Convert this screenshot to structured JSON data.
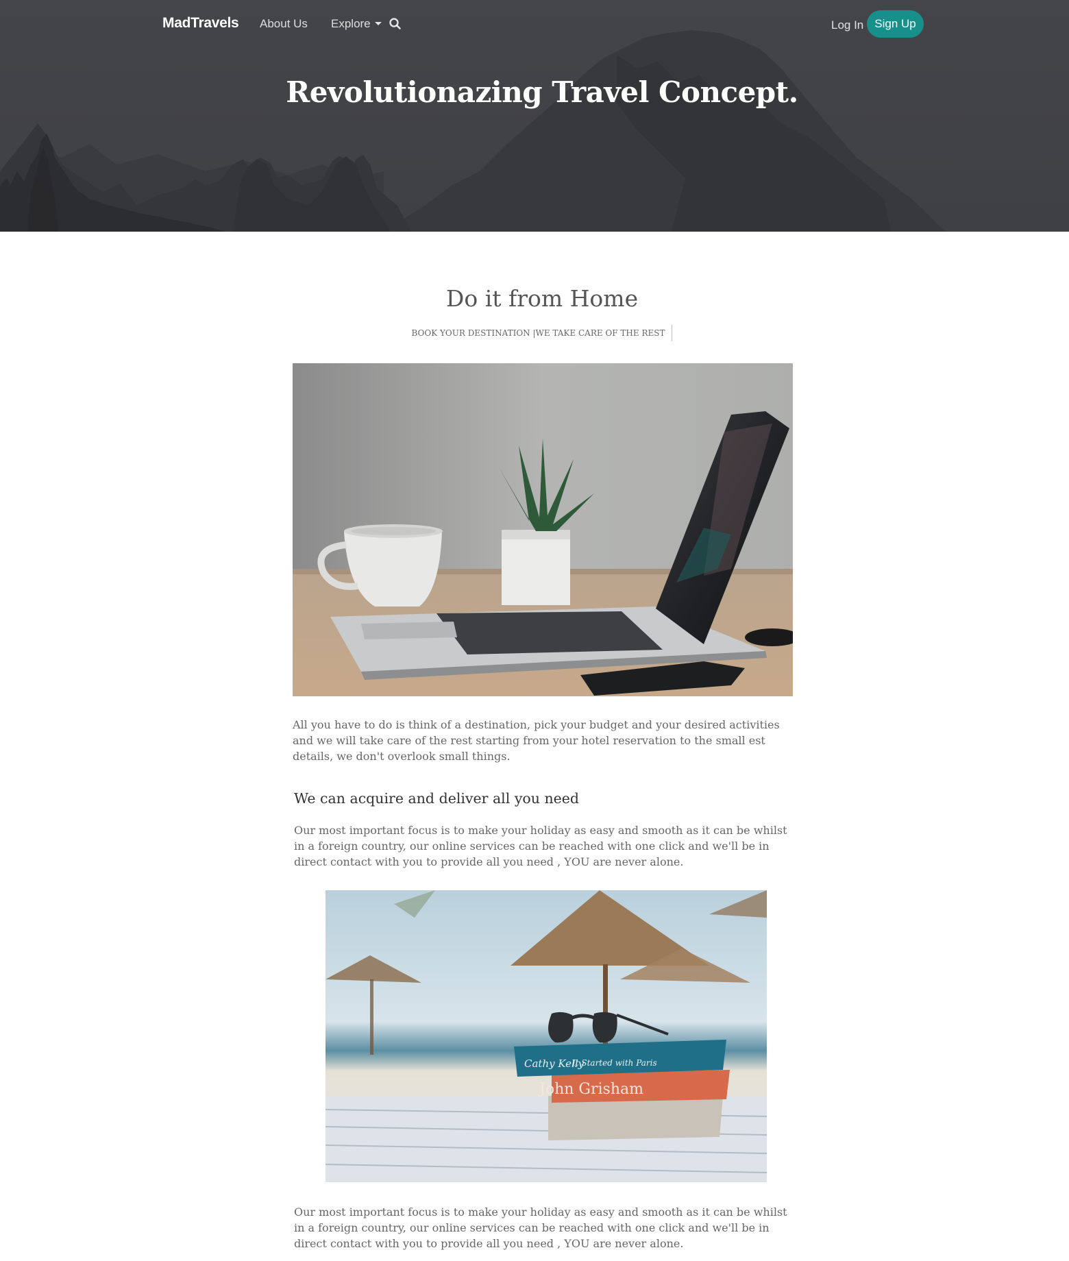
{
  "nav": {
    "brand": "MadTravels",
    "about": "About Us",
    "explore": "Explore",
    "login": "Log In",
    "signup": "Sign Up"
  },
  "hero": {
    "title": "Revolutionazing Travel Concept."
  },
  "intro": {
    "title": "Do it from Home",
    "subtitle": "BOOK YOUR DESTINATION |WE TAKE CARE OF THE REST"
  },
  "content": {
    "para1": "All you have to do is think of a destination, pick your budget and your desired activities and we will take care of the rest starting from your hotel reservation to the small est details, we don't overlook small things.",
    "heading": "We can acquire and deliver all you need",
    "para2": "Our most important focus is to make your holiday as easy and smooth as it can be whilst in a foreign country, our online services can be reached with one click and we'll be in direct contact with you to provide all you need , YOU are never alone.",
    "para3": "Our most important focus is to make your holiday as easy and smooth as it can be whilst in a foreign country, our online services can be reached with one click and we'll be in direct contact with you to provide all you need , YOU are never alone."
  },
  "book_covers": {
    "book1_author": "Cathy Kelly",
    "book1_title": "It Started with Paris",
    "book2_author": "John Grisham"
  },
  "colors": {
    "accent": "#17908c",
    "hero_bg": "#434447"
  },
  "icons": {
    "search": "search-icon"
  }
}
